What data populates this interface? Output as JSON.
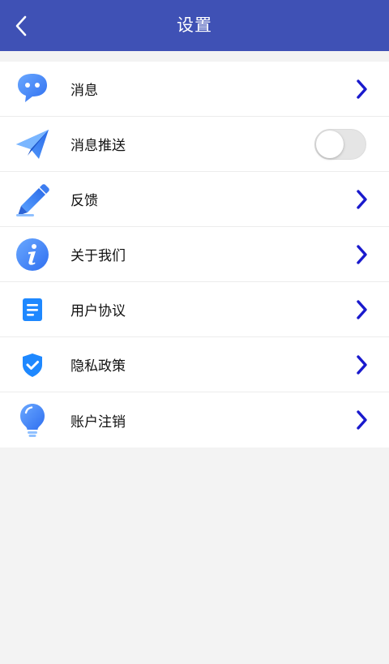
{
  "header": {
    "title": "设置",
    "back_icon": "chevron-left-icon"
  },
  "colors": {
    "header_bg": "#3f51b5",
    "chevron": "#1a1acd",
    "icon_blue": "#2d8cf0"
  },
  "settings": {
    "items": [
      {
        "label": "消息",
        "icon": "chat-bubble-icon",
        "control": "chevron"
      },
      {
        "label": "消息推送",
        "icon": "paper-plane-icon",
        "control": "toggle",
        "toggle_on": false
      },
      {
        "label": "反馈",
        "icon": "pencil-icon",
        "control": "chevron"
      },
      {
        "label": "关于我们",
        "icon": "info-icon",
        "control": "chevron"
      },
      {
        "label": "用户协议",
        "icon": "document-icon",
        "control": "chevron"
      },
      {
        "label": "隐私政策",
        "icon": "shield-check-icon",
        "control": "chevron"
      },
      {
        "label": "账户注销",
        "icon": "lightbulb-icon",
        "control": "chevron"
      }
    ]
  }
}
